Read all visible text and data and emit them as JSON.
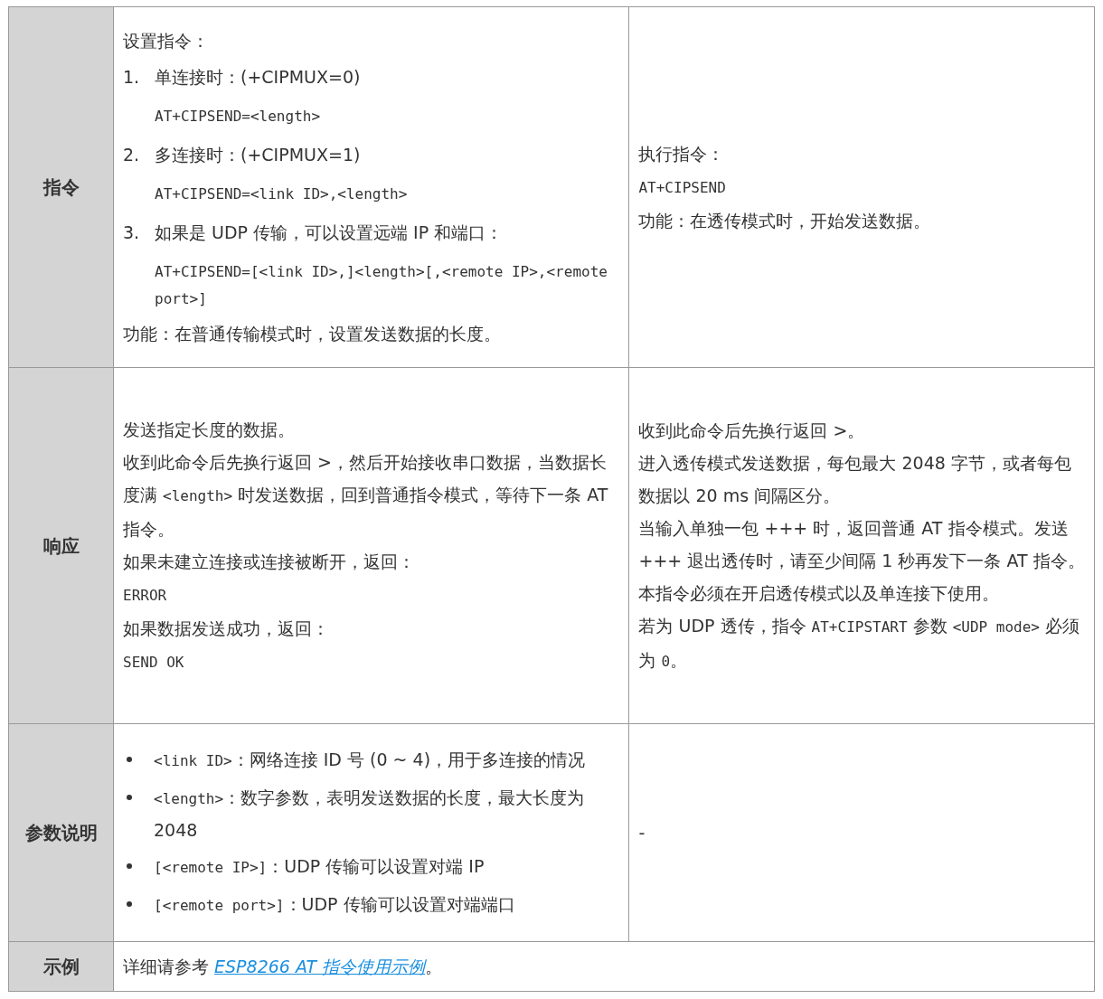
{
  "table": {
    "rows": [
      {
        "header": "指令",
        "cells": [
          {
            "blocks": [
              {
                "kind": "para",
                "runs": [
                  {
                    "kind": "text",
                    "text": "设置指令："
                  }
                ]
              },
              {
                "kind": "item",
                "number": "1.",
                "runs": [
                  {
                    "kind": "text",
                    "text": "单连接时：(+CIPMUX=0)"
                  }
                ]
              },
              {
                "kind": "code",
                "runs": [
                  {
                    "kind": "code",
                    "text": "AT+CIPSEND=<length>"
                  }
                ]
              },
              {
                "kind": "item",
                "number": "2.",
                "runs": [
                  {
                    "kind": "text",
                    "text": "多连接时：(+CIPMUX=1)"
                  }
                ]
              },
              {
                "kind": "code",
                "runs": [
                  {
                    "kind": "code",
                    "text": "AT+CIPSEND=<link ID>,<length>"
                  }
                ]
              },
              {
                "kind": "item",
                "number": "3.",
                "runs": [
                  {
                    "kind": "text",
                    "text": "如果是 UDP 传输，可以设置远端 IP 和端口："
                  }
                ]
              },
              {
                "kind": "code",
                "runs": [
                  {
                    "kind": "code",
                    "text": "AT+CIPSEND=[<link ID>,]<length>[,<remote IP>,<remote port>]"
                  }
                ]
              },
              {
                "kind": "para",
                "runs": [
                  {
                    "kind": "text",
                    "text": "功能：在普通传输模式时，设置发送数据的长度。"
                  }
                ]
              }
            ]
          },
          {
            "blocks": [
              {
                "kind": "para",
                "runs": [
                  {
                    "kind": "text",
                    "text": "执行指令："
                  }
                ]
              },
              {
                "kind": "para",
                "runs": [
                  {
                    "kind": "code",
                    "text": "AT+CIPSEND"
                  }
                ]
              },
              {
                "kind": "para",
                "runs": [
                  {
                    "kind": "text",
                    "text": "功能：在透传模式时，开始发送数据。"
                  }
                ]
              }
            ]
          }
        ]
      },
      {
        "header": "响应",
        "cells": [
          {
            "blocks": [
              {
                "kind": "para",
                "runs": [
                  {
                    "kind": "text",
                    "text": "发送指定长度的数据。"
                  }
                ]
              },
              {
                "kind": "para",
                "runs": [
                  {
                    "kind": "text",
                    "text": "收到此命令后先换行返回 >，然后开始接收串口数据，当数据长度满 "
                  },
                  {
                    "kind": "code",
                    "text": "<length>"
                  },
                  {
                    "kind": "text",
                    "text": " 时发送数据，回到普通指令模式，等待下一条 AT 指令。"
                  }
                ]
              },
              {
                "kind": "para",
                "runs": [
                  {
                    "kind": "text",
                    "text": "如果未建立连接或连接被断开，返回："
                  }
                ]
              },
              {
                "kind": "para",
                "runs": [
                  {
                    "kind": "code",
                    "text": "ERROR"
                  }
                ]
              },
              {
                "kind": "para",
                "runs": [
                  {
                    "kind": "text",
                    "text": "如果数据发送成功，返回："
                  }
                ]
              },
              {
                "kind": "para",
                "runs": [
                  {
                    "kind": "code",
                    "text": "SEND OK"
                  }
                ]
              }
            ]
          },
          {
            "blocks": [
              {
                "kind": "para",
                "runs": [
                  {
                    "kind": "text",
                    "text": "收到此命令后先换行返回 >。"
                  }
                ]
              },
              {
                "kind": "para",
                "runs": [
                  {
                    "kind": "text",
                    "text": "进入透传模式发送数据，每包最大 2048 字节，或者每包数据以 20 ms 间隔区分。"
                  }
                ]
              },
              {
                "kind": "para",
                "runs": [
                  {
                    "kind": "text",
                    "text": "当输入单独一包 +++ 时，返回普通 AT 指令模式。发送 +++ 退出透传时，请至少间隔 1 秒再发下一条 AT 指令。"
                  }
                ]
              },
              {
                "kind": "para",
                "runs": [
                  {
                    "kind": "text",
                    "text": "本指令必须在开启透传模式以及单连接下使用。"
                  }
                ]
              },
              {
                "kind": "para",
                "runs": [
                  {
                    "kind": "text",
                    "text": "若为 UDP 透传，指令 "
                  },
                  {
                    "kind": "code",
                    "text": "AT+CIPSTART"
                  },
                  {
                    "kind": "text",
                    "text": " 参数 "
                  },
                  {
                    "kind": "code",
                    "text": "<UDP mode>"
                  },
                  {
                    "kind": "text",
                    "text": " 必须为 "
                  },
                  {
                    "kind": "code",
                    "text": "0"
                  },
                  {
                    "kind": "text",
                    "text": "。"
                  }
                ]
              }
            ]
          }
        ]
      },
      {
        "header": "参数说明",
        "cells": [
          {
            "blocks": [
              {
                "kind": "bullet",
                "runs": [
                  {
                    "kind": "code",
                    "text": "<link ID>"
                  },
                  {
                    "kind": "text",
                    "text": "：网络连接 ID 号 (0 ~ 4)，用于多连接的情况"
                  }
                ]
              },
              {
                "kind": "bullet",
                "runs": [
                  {
                    "kind": "code",
                    "text": "<length>"
                  },
                  {
                    "kind": "text",
                    "text": "：数字参数，表明发送数据的长度，最大长度为 2048"
                  }
                ]
              },
              {
                "kind": "bullet",
                "runs": [
                  {
                    "kind": "code",
                    "text": "[<remote IP>]"
                  },
                  {
                    "kind": "text",
                    "text": "：UDP 传输可以设置对端 IP"
                  }
                ]
              },
              {
                "kind": "bullet",
                "runs": [
                  {
                    "kind": "code",
                    "text": "[<remote port>]"
                  },
                  {
                    "kind": "text",
                    "text": "：UDP 传输可以设置对端端口"
                  }
                ]
              }
            ]
          },
          {
            "blocks": [
              {
                "kind": "para",
                "runs": [
                  {
                    "kind": "text",
                    "text": "-"
                  }
                ]
              }
            ]
          }
        ]
      },
      {
        "header": "示例",
        "cells": [
          {
            "blocks": [
              {
                "kind": "para",
                "runs": [
                  {
                    "kind": "text",
                    "text": "详细请参考 "
                  },
                  {
                    "kind": "link",
                    "text": "ESP8266 AT 指令使用示例"
                  },
                  {
                    "kind": "text",
                    "text": "。"
                  }
                ]
              }
            ]
          }
        ]
      }
    ]
  }
}
